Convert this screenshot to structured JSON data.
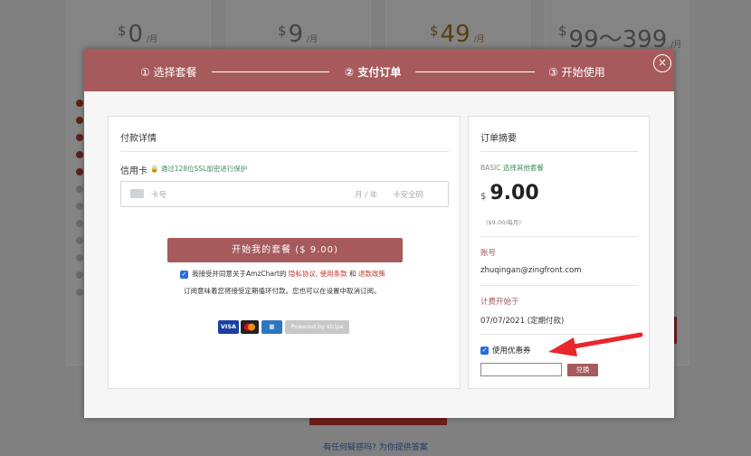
{
  "background": {
    "plans": [
      {
        "currency": "$",
        "price": "0",
        "per": "/月"
      },
      {
        "currency": "$",
        "price": "9",
        "per": "/月"
      },
      {
        "currency": "$",
        "price": "49",
        "per": "/月"
      },
      {
        "currency": "$",
        "price": "99～399",
        "per": "/月"
      }
    ],
    "help_link": "有任何疑惑吗? 为你提供答案"
  },
  "steps": [
    {
      "label": "① 选择套餐",
      "active": false
    },
    {
      "label": "② 支付订单",
      "active": true
    },
    {
      "label": "③ 开始使用",
      "active": false
    }
  ],
  "close_icon": "×",
  "payment": {
    "title": "付款详情",
    "card_label": "信用卡",
    "ssl_note": "通过128位SSL加密进行保护",
    "card_number_placeholder": "卡号",
    "expiry_placeholder": "月 / 年",
    "cvc_placeholder": "卡安全码",
    "start_button": "开始我的套餐 ($ 9.00)",
    "agree_prefix": "我接受并同意关于AmzChart的",
    "privacy_link": "隐私协议",
    "terms_link": "使用条款",
    "and_text": "和",
    "refund_link": "退款政策",
    "subscription_note": "订阅意味着您将接受定期循环付款。您也可以在设置中取消订阅。",
    "logos": {
      "visa": "VISA",
      "stripe": "Powered by stripe"
    }
  },
  "summary": {
    "title": "订单摘要",
    "plan_name": "BASIC",
    "change_plan_link": "选择其他套餐",
    "currency": "$",
    "price": "9.00",
    "price_note": "($9.00/每月)",
    "account_label": "账号",
    "account_value": "zhuqingan@zingfront.com",
    "billing_label": "计费开始于",
    "billing_value": "07/07/2021 (定期付款)",
    "coupon_label": "使用优惠券",
    "coupon_value": "",
    "redeem_button": "兑换"
  },
  "colors": {
    "accent": "#a75a5b",
    "overlay": "#808080",
    "arrow": "#e8262c",
    "checkbox": "#2a6fd6"
  }
}
